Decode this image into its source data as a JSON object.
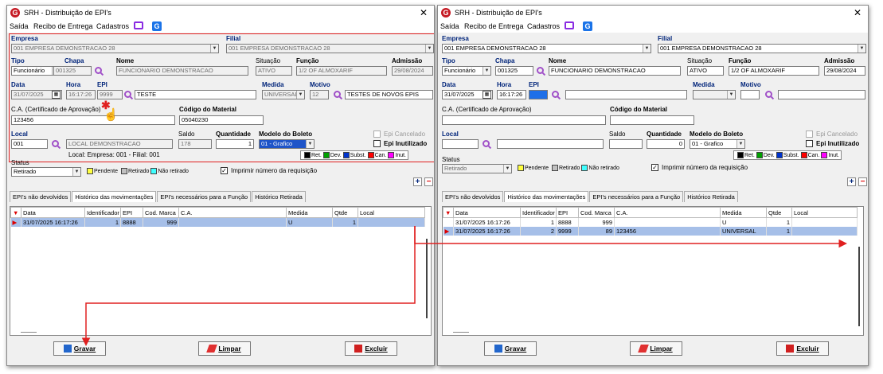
{
  "window_left": {
    "title": "SRH - Distribuição de EPI's",
    "menu": [
      "Saída",
      "Recibo de Entrega",
      "Cadastros"
    ],
    "empresa_label": "Empresa",
    "empresa_value": "001 EMPRESA DEMONSTRACAO 28",
    "filial_label": "Filial",
    "filial_value": "001 EMPRESA DEMONSTRACAO 28",
    "tipo_label": "Tipo",
    "tipo_value": "Funcionário",
    "chapa_label": "Chapa",
    "chapa_value": "001325",
    "nome_label": "Nome",
    "nome_value": "FUNCIONARIO DEMONSTRACAO",
    "situacao_label": "Situação",
    "situacao_value": "ATIVO",
    "funcao_label": "Função",
    "funcao_value": "1/2 OF ALMOXARIF",
    "admissao_label": "Admissão",
    "admissao_value": "29/08/2024",
    "data_label": "Data",
    "data_value": "31/07/2025",
    "hora_label": "Hora",
    "hora_value": "16:17:26",
    "epi_label": "EPI",
    "epi_value": "9999",
    "epi_desc": "TESTE",
    "medida_label": "Medida",
    "medida_value": "UNIVERSAL",
    "motivo_label": "Motivo",
    "motivo_value": "12",
    "motivo_desc": "TESTES DE NOVOS EPIS",
    "ca_label": "C.A. (Certificado de Aprovação)",
    "ca_value": "123456",
    "codmat_label": "Código do Material",
    "codmat_value": "05040230",
    "local_label": "Local",
    "local_value": "001",
    "local_desc": "LOCAL DEMONSTRACAO",
    "saldo_label": "Saldo",
    "saldo_value": "178",
    "qtd_label": "Quantidade",
    "qtd_value": "1",
    "modelo_label": "Modelo do Boleto",
    "modelo_value": "01 - Grafico",
    "epi_cancelado": "Epi Cancelado",
    "epi_inutilizado": "Epi Inutilizado",
    "local_info": "Local: Empresa: 001 - Filial: 001",
    "status_label": "Status",
    "status_value": "Retirado",
    "tabs": [
      "EPI's não devolvidos",
      "Histórico das movimentações",
      "EPI's necessários para a Função",
      "Histórico Retirada"
    ],
    "rows": [
      {
        "data": "31/07/2025 16:17:26",
        "id": "1",
        "epi": "8888",
        "marca": "999",
        "ca": "",
        "medida": "U",
        "qtde": "1",
        "local": ""
      }
    ],
    "btn_gravar": "Gravar",
    "btn_limpar": "Limpar",
    "btn_excluir": "Excluir"
  },
  "window_right": {
    "title": "SRH - Distribuição de EPI's",
    "menu": [
      "Saída",
      "Recibo de Entrega",
      "Cadastros"
    ],
    "empresa_label": "Empresa",
    "empresa_value": "001 EMPRESA DEMONSTRACAO 28",
    "filial_label": "Filial",
    "filial_value": "001 EMPRESA DEMONSTRACAO 28",
    "tipo_label": "Tipo",
    "tipo_value": "Funcionário",
    "chapa_label": "Chapa",
    "chapa_value": "001325",
    "nome_label": "Nome",
    "nome_value": "FUNCIONARIO DEMONSTRACAO",
    "situacao_label": "Situação",
    "situacao_value": "ATIVO",
    "funcao_label": "Função",
    "funcao_value": "1/2 OF ALMOXARIF",
    "admissao_label": "Admissão",
    "admissao_value": "29/08/2024",
    "data_label": "Data",
    "data_value": "31/07/2025",
    "hora_label": "Hora",
    "hora_value": "16:17:26",
    "epi_label": "EPI",
    "medida_label": "Medida",
    "motivo_label": "Motivo",
    "ca_label": "C.A. (Certificado de Aprovação)",
    "codmat_label": "Código do Material",
    "local_label": "Local",
    "saldo_label": "Saldo",
    "qtd_label": "Quantidade",
    "qtd_value": "0",
    "modelo_label": "Modelo do Boleto",
    "modelo_value": "01 - Grafico",
    "epi_cancelado": "Epi Cancelado",
    "epi_inutilizado": "Epi Inutilizado",
    "status_label": "Status",
    "status_value": "Retirado",
    "tabs": [
      "EPI's não devolvidos",
      "Histórico das movimentações",
      "EPI's necessários para a Função",
      "Histórico Retirada"
    ],
    "rows": [
      {
        "data": "31/07/2025 16:17:26",
        "id": "1",
        "epi": "8888",
        "marca": "999",
        "ca": "",
        "medida": "U",
        "qtde": "1",
        "local": ""
      },
      {
        "data": "31/07/2025 16:17:26",
        "id": "2",
        "epi": "9999",
        "marca": "89",
        "ca": "123456",
        "medida": "UNIVERSAL",
        "qtde": "1",
        "local": ""
      }
    ],
    "btn_gravar": "Gravar",
    "btn_limpar": "Limpar",
    "btn_excluir": "Excluir"
  },
  "legend": [
    "Ret.",
    "Dev.",
    "Subst.",
    "Can.",
    "Inut."
  ],
  "legend_colors": [
    "#000000",
    "#00a000",
    "#0033cc",
    "#ff0000",
    "#ff00ff"
  ],
  "status_legend": [
    "Pendente",
    "Retirado",
    "Não retirado"
  ],
  "status_colors": [
    "#ffff40",
    "#c0c0c0",
    "#40ffff"
  ],
  "print_checkbox": "Imprimir número da requisição",
  "grid_headers": [
    "Data",
    "Identificador",
    "EPI",
    "Cod. Marca",
    "C.A.",
    "Medida",
    "Qtde",
    "Local"
  ],
  "annotation_color": "#e02020"
}
